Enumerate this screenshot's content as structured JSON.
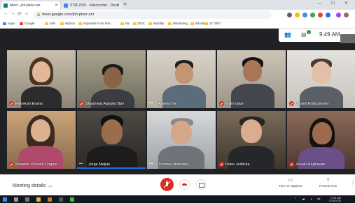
{
  "browser": {
    "tabs": [
      {
        "label": "Meet - jnh-pbxz-zzz",
        "active": true
      },
      {
        "label": "STM 2020 · videoconfer · Docs",
        "active": false
      }
    ],
    "new_tab": "+",
    "window_controls": "— ☐ ✕",
    "nav": {
      "back": "←",
      "forward": "→",
      "reload": "⟳",
      "home": "⌂"
    },
    "url": "meet.google.com/jnh-pbxz-zzz",
    "bookmarks": [
      "Apps",
      "Google",
      "utils",
      "Python",
      "Imported From Fire...",
      "ML",
      "DOC",
      "Mobility",
      "Monitoring",
      "Biloxili",
      "1T 2007"
    ]
  },
  "meet": {
    "topbar": {
      "participants_icon": "people-icon",
      "chat_badge": "1",
      "time": "9:49 AM"
    },
    "participants": [
      {
        "name": "Rebekah Evans",
        "muted": true
      },
      {
        "name": "Shashwat Appuku Bav",
        "muted": true
      },
      {
        "name": "Aravind Ve",
        "muted": false
      },
      {
        "name": "shilin dave",
        "muted": true
      },
      {
        "name": "Leonid Rotschinsky",
        "muted": true
      },
      {
        "name": "Soledad Donoso Cogner",
        "muted": true
      },
      {
        "name": "Jorge Mejias",
        "muted": false
      },
      {
        "name": "Thomas Nowotny",
        "muted": false
      },
      {
        "name": "Peter Jedlicka",
        "muted": true
      },
      {
        "name": "Janaki Raghavan",
        "muted": true
      }
    ],
    "bottom": {
      "meeting_details": "Meeting details",
      "captions_label": "Turn on captions",
      "present_label": "Present now"
    }
  },
  "taskbar": {
    "time": "9:49 AM",
    "date": "7/24/2020"
  },
  "colors": {
    "accent": "#1a73e8",
    "danger": "#d93025",
    "meet_bg": "#202124"
  }
}
